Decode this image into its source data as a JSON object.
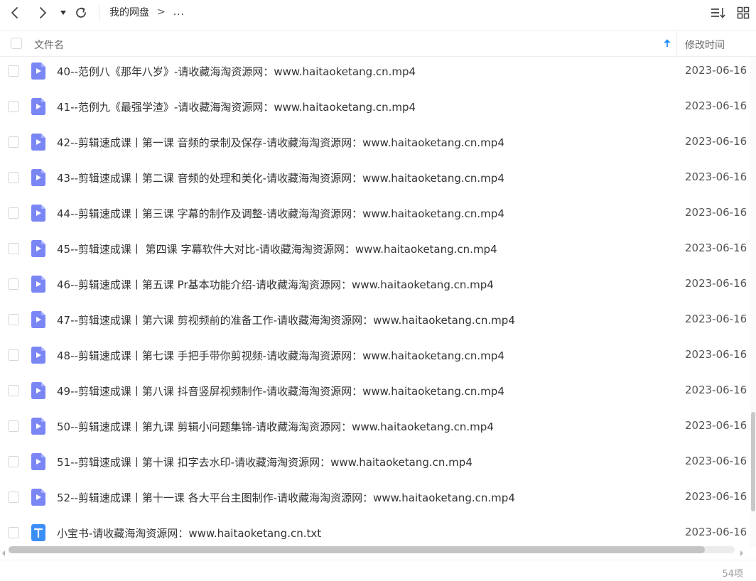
{
  "toolbar": {
    "breadcrumb_root": "我的网盘",
    "breadcrumb_separator": ">",
    "breadcrumb_more": "...",
    "icons": [
      "back-icon",
      "forward-icon",
      "history-dropdown-icon",
      "refresh-icon",
      "sort-list-icon",
      "grid-view-icon"
    ]
  },
  "header": {
    "name_label": "文件名",
    "time_label": "修改时间",
    "sort_direction": "ascending"
  },
  "files": [
    {
      "name": "40--范例八《那年八岁》-请收藏海淘资源网：www.haitaoketang.cn.mp4",
      "date": "2023-06-16",
      "type": "video"
    },
    {
      "name": "41--范例九《最强学渣》-请收藏海淘资源网：www.haitaoketang.cn.mp4",
      "date": "2023-06-16",
      "type": "video"
    },
    {
      "name": "42--剪辑速成课丨第一课 音频的录制及保存-请收藏海淘资源网：www.haitaoketang.cn.mp4",
      "date": "2023-06-16",
      "type": "video"
    },
    {
      "name": "43--剪辑速成课丨第二课 音频的处理和美化-请收藏海淘资源网：www.haitaoketang.cn.mp4",
      "date": "2023-06-16",
      "type": "video"
    },
    {
      "name": "44--剪辑速成课丨第三课 字幕的制作及调整-请收藏海淘资源网：www.haitaoketang.cn.mp4",
      "date": "2023-06-16",
      "type": "video"
    },
    {
      "name": "45--剪辑速成课丨 第四课 字幕软件大对比-请收藏海淘资源网：www.haitaoketang.cn.mp4",
      "date": "2023-06-16",
      "type": "video"
    },
    {
      "name": "46--剪辑速成课丨第五课 Pr基本功能介绍-请收藏海淘资源网：www.haitaoketang.cn.mp4",
      "date": "2023-06-16",
      "type": "video"
    },
    {
      "name": "47--剪辑速成课丨第六课 剪视频前的准备工作-请收藏海淘资源网：www.haitaoketang.cn.mp4",
      "date": "2023-06-16",
      "type": "video"
    },
    {
      "name": "48--剪辑速成课丨第七课 手把手带你剪视频-请收藏海淘资源网：www.haitaoketang.cn.mp4",
      "date": "2023-06-16",
      "type": "video"
    },
    {
      "name": "49--剪辑速成课丨第八课 抖音竖屏视频制作-请收藏海淘资源网：www.haitaoketang.cn.mp4",
      "date": "2023-06-16",
      "type": "video"
    },
    {
      "name": "50--剪辑速成课丨第九课 剪辑小问题集锦-请收藏海淘资源网：www.haitaoketang.cn.mp4",
      "date": "2023-06-16",
      "type": "video"
    },
    {
      "name": "51--剪辑速成课丨第十课 扣字去水印-请收藏海淘资源网：www.haitaoketang.cn.mp4",
      "date": "2023-06-16",
      "type": "video"
    },
    {
      "name": "52--剪辑速成课丨第十一课 各大平台主图制作-请收藏海淘资源网：www.haitaoketang.cn.mp4",
      "date": "2023-06-16",
      "type": "video"
    },
    {
      "name": "小宝书-请收藏海淘资源网：www.haitaoketang.cn.txt",
      "date": "2023-06-16",
      "type": "text"
    }
  ],
  "footer": {
    "item_count": "54项"
  },
  "colors": {
    "video_icon": "#7b86f5",
    "text_icon": "#3a8ef6",
    "sort_arrow": "#1e8fff"
  }
}
